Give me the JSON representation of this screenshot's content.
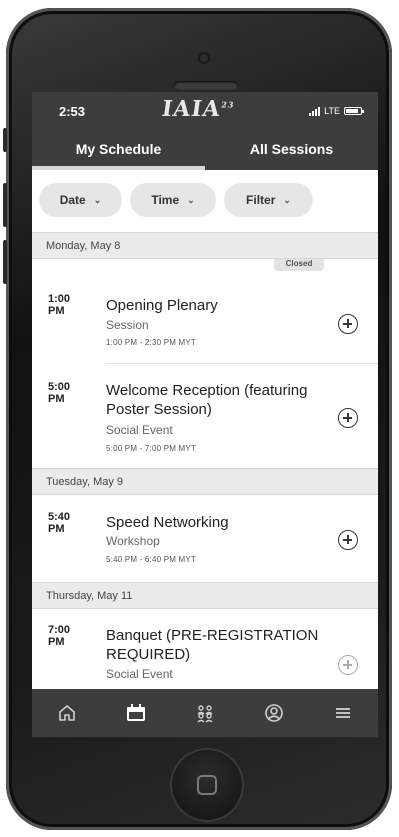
{
  "status": {
    "time": "2:53",
    "network": "LTE"
  },
  "brand": {
    "logo_text": "IAIA",
    "logo_sup": "23"
  },
  "tabs": [
    {
      "label": "My Schedule",
      "active": true
    },
    {
      "label": "All Sessions",
      "active": false
    }
  ],
  "filters": [
    {
      "label": "Date"
    },
    {
      "label": "Time"
    },
    {
      "label": "Filter"
    }
  ],
  "days": [
    {
      "label": "Monday, May 8"
    },
    {
      "label": "Tuesday, May 9"
    },
    {
      "label": "Thursday, May 11"
    }
  ],
  "closed_chip": "Closed",
  "sessions": [
    {
      "time": "1:00 PM",
      "title": "Opening Plenary",
      "type": "Session",
      "range": "1:00 PM - 2:30 PM MYT"
    },
    {
      "time": "5:00 PM",
      "title": "Welcome Reception (featuring Poster Session)",
      "type": "Social Event",
      "range": "5:00 PM - 7:00 PM MYT"
    },
    {
      "time": "5:40 PM",
      "title": "Speed Networking",
      "type": "Workshop",
      "range": "5:40 PM - 6:40 PM MYT"
    },
    {
      "time": "7:00 PM",
      "title": "Banquet (PRE-REGISTRATION REQUIRED)",
      "type": "Social Event",
      "range": ""
    }
  ],
  "nav": [
    {
      "icon": "home-icon"
    },
    {
      "icon": "calendar-icon"
    },
    {
      "icon": "people-icon"
    },
    {
      "icon": "profile-icon"
    },
    {
      "icon": "menu-icon"
    }
  ],
  "colors": {
    "bar": "#3d3d3d",
    "day_header": "#ebebeb",
    "pill": "#e6e6e6"
  }
}
